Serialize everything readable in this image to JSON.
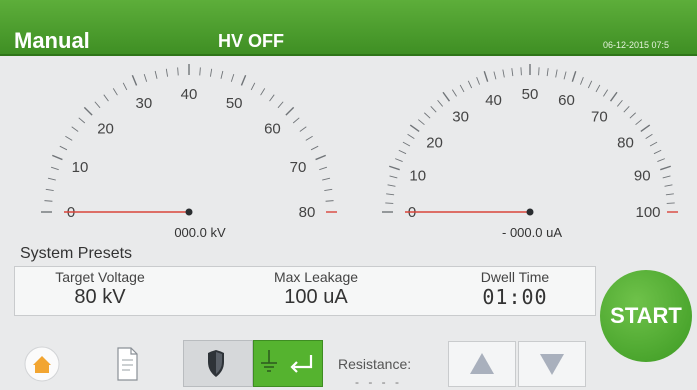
{
  "header": {
    "mode": "Manual",
    "hv_status": "HV OFF",
    "datetime": "06-12-2015 07:5"
  },
  "gauges": {
    "voltage": {
      "labels": [
        "0",
        "10",
        "20",
        "30",
        "40",
        "50",
        "60",
        "70",
        "80"
      ],
      "value": 0,
      "readout": "000.0 kV"
    },
    "leakage": {
      "labels": [
        "0",
        "10",
        "20",
        "30",
        "40",
        "50",
        "60",
        "70",
        "80",
        "90",
        "100"
      ],
      "value": 0,
      "readout": "- 000.0 uA"
    }
  },
  "presets": {
    "title": "System Presets",
    "target_voltage_label": "Target Voltage",
    "target_voltage_value": "80 kV",
    "max_leakage_label": "Max Leakage",
    "max_leakage_value": "100 uA",
    "dwell_time_label": "Dwell Time",
    "dwell_time_value": "01:00"
  },
  "start_label": "START",
  "bottom": {
    "resistance_label": "Resistance:",
    "resistance_value": "- - - -"
  },
  "icons": {
    "home": "home-icon",
    "document": "document-icon",
    "shield": "shield-icon",
    "ground": "ground-icon",
    "enter": "enter-arrow-icon",
    "up": "up-arrow-icon",
    "down": "down-arrow-icon"
  },
  "colors": {
    "header_green": "#4aa12c",
    "needle_red": "#d9443a",
    "start_green": "#4caf2e",
    "home_orange": "#f2a531"
  }
}
